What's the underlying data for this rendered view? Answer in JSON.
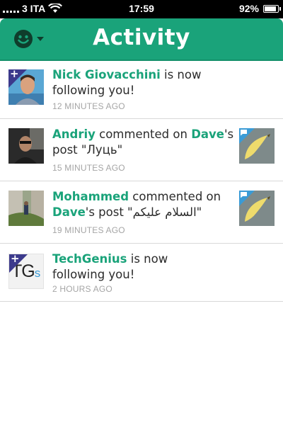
{
  "status_bar": {
    "carrier": "3 ITA",
    "time": "17:59",
    "battery": "92%",
    "battery_fraction": 0.92
  },
  "header": {
    "title": "Activity",
    "menu_icon": "vine-logo-icon"
  },
  "activities": [
    {
      "user": "Nick Giovacchini",
      "text_after": " is now following you!",
      "time": "12 MINUTES AGO"
    },
    {
      "user": "Andriy",
      "text_mid": " commented on ",
      "owner": "Dave",
      "text_after": "'s post \"Луць\"",
      "time": "15 MINUTES AGO"
    },
    {
      "user": "Mohammed",
      "text_mid": " commented on ",
      "owner": "Dave",
      "text_after": "'s post \"السلام عليكم\"",
      "time": "19 MINUTES AGO"
    },
    {
      "user": "TechGenius",
      "text_after": " is now following you!",
      "time": "2 HOURS AGO",
      "avatar_text": "TG",
      "avatar_sub": "s"
    }
  ],
  "badge": {
    "plus": "+"
  },
  "colors": {
    "accent": "#1aa37a",
    "badge_purple": "#3c3a8c",
    "badge_blue": "#3a9bd6"
  }
}
